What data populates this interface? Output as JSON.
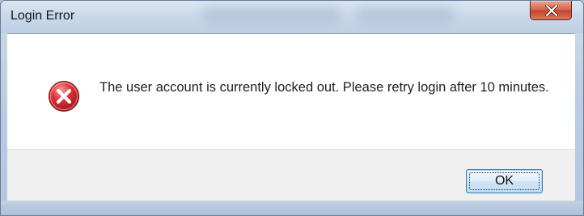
{
  "dialog": {
    "title": "Login Error",
    "message": "The user account is currently locked out. Please retry login after 10 minutes.",
    "ok_label": "OK",
    "icon": "error-icon",
    "close_icon": "close-icon"
  },
  "colors": {
    "error_red": "#d8262c",
    "close_button": "#c4462c",
    "ok_border": "#3c7fb1"
  }
}
